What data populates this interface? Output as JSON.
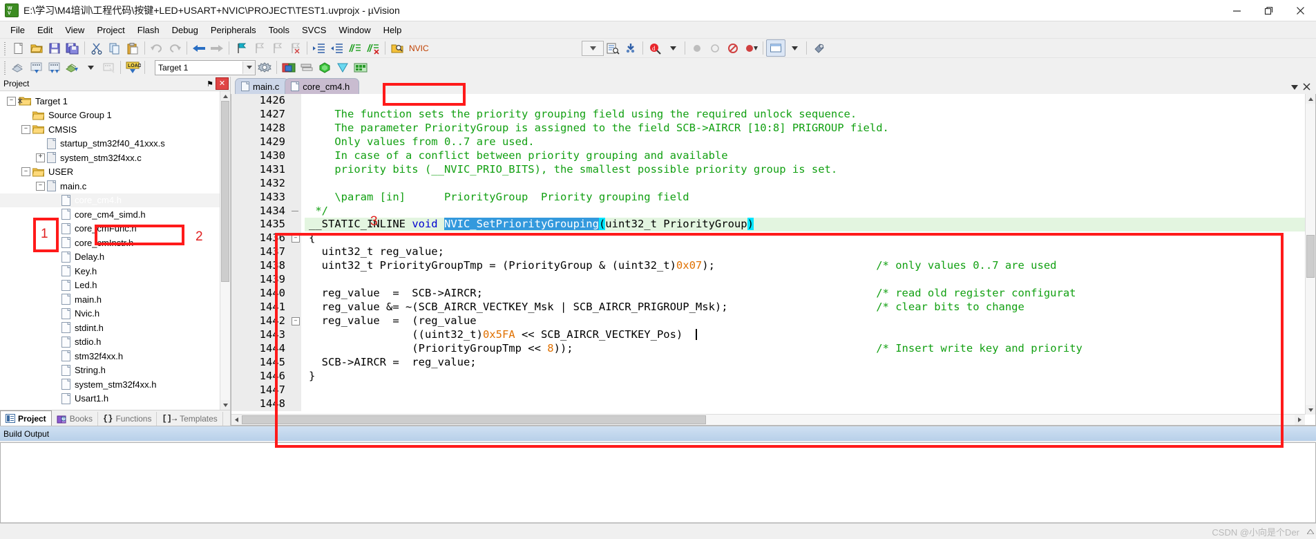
{
  "window": {
    "title": "E:\\学习\\M4培训\\工程代码\\按键+LED+USART+NVIC\\PROJECT\\TEST1.uvprojx - µVision",
    "minimize_label": "—",
    "maximize_label": "❐",
    "close_label": "✕"
  },
  "menu": {
    "items": [
      {
        "label": "File"
      },
      {
        "label": "Edit"
      },
      {
        "label": "View"
      },
      {
        "label": "Project"
      },
      {
        "label": "Flash"
      },
      {
        "label": "Debug"
      },
      {
        "label": "Peripherals"
      },
      {
        "label": "Tools"
      },
      {
        "label": "SVCS"
      },
      {
        "label": "Window"
      },
      {
        "label": "Help"
      }
    ]
  },
  "toolbar": {
    "find_value": "NVIC",
    "target_value": "Target 1"
  },
  "project_pane": {
    "title": "Project",
    "close_label": "✕",
    "pin_label": "⚑",
    "tree": [
      {
        "label": "Target 1",
        "indent": 1,
        "type": "target",
        "expander": "-"
      },
      {
        "label": "Source Group 1",
        "indent": 2,
        "type": "folder",
        "expander": ""
      },
      {
        "label": "CMSIS",
        "indent": 2,
        "type": "folder",
        "expander": "-"
      },
      {
        "label": "startup_stm32f40_41xxx.s",
        "indent": 3,
        "type": "file",
        "expander": ""
      },
      {
        "label": "system_stm32f4xx.c",
        "indent": 3,
        "type": "file",
        "expander": "+"
      },
      {
        "label": "USER",
        "indent": 2,
        "type": "folder",
        "expander": "-"
      },
      {
        "label": "main.c",
        "indent": 3,
        "type": "file",
        "expander": "-"
      },
      {
        "label": "core_cm4.h",
        "indent": 4,
        "type": "file",
        "expander": "",
        "selected": true
      },
      {
        "label": "core_cm4_simd.h",
        "indent": 4,
        "type": "file",
        "expander": ""
      },
      {
        "label": "core_cmFunc.h",
        "indent": 4,
        "type": "file",
        "expander": ""
      },
      {
        "label": "core_cmInstr.h",
        "indent": 4,
        "type": "file",
        "expander": ""
      },
      {
        "label": "Delay.h",
        "indent": 4,
        "type": "file",
        "expander": ""
      },
      {
        "label": "Key.h",
        "indent": 4,
        "type": "file",
        "expander": ""
      },
      {
        "label": "Led.h",
        "indent": 4,
        "type": "file",
        "expander": ""
      },
      {
        "label": "main.h",
        "indent": 4,
        "type": "file",
        "expander": ""
      },
      {
        "label": "Nvic.h",
        "indent": 4,
        "type": "file",
        "expander": ""
      },
      {
        "label": "stdint.h",
        "indent": 4,
        "type": "file",
        "expander": ""
      },
      {
        "label": "stdio.h",
        "indent": 4,
        "type": "file",
        "expander": ""
      },
      {
        "label": "stm32f4xx.h",
        "indent": 4,
        "type": "file",
        "expander": ""
      },
      {
        "label": "String.h",
        "indent": 4,
        "type": "file",
        "expander": ""
      },
      {
        "label": "system_stm32f4xx.h",
        "indent": 4,
        "type": "file",
        "expander": ""
      },
      {
        "label": "Usart1.h",
        "indent": 4,
        "type": "file",
        "expander": ""
      }
    ],
    "tabs": [
      {
        "label": "Project",
        "icon": "project-icon",
        "active": true
      },
      {
        "label": "Books",
        "icon": "books-icon",
        "active": false
      },
      {
        "label": "Functions",
        "icon": "braces-icon",
        "active": false
      },
      {
        "label": "Templates",
        "icon": "templates-icon",
        "active": false
      }
    ]
  },
  "editor": {
    "tabs": [
      {
        "label": "main.c",
        "active": false
      },
      {
        "label": "core_cm4.h",
        "active": true
      }
    ],
    "first_line": 1426,
    "lines": [
      {
        "n": 1426,
        "segs": [],
        "fold": ""
      },
      {
        "n": 1427,
        "segs": [
          {
            "t": "    The function sets the priority grouping field using the required unlock sequence.",
            "c": "cm"
          }
        ],
        "fold": ""
      },
      {
        "n": 1428,
        "segs": [
          {
            "t": "    The parameter PriorityGroup is assigned to the field SCB->AIRCR [10:8] PRIGROUP field.",
            "c": "cm"
          }
        ],
        "fold": ""
      },
      {
        "n": 1429,
        "segs": [
          {
            "t": "    Only values from 0..7 are used.",
            "c": "cm"
          }
        ],
        "fold": ""
      },
      {
        "n": 1430,
        "segs": [
          {
            "t": "    In case of a conflict between priority grouping and available",
            "c": "cm"
          }
        ],
        "fold": ""
      },
      {
        "n": 1431,
        "segs": [
          {
            "t": "    priority bits (__NVIC_PRIO_BITS), the smallest possible priority group is set.",
            "c": "cm"
          }
        ],
        "fold": ""
      },
      {
        "n": 1432,
        "segs": [],
        "fold": ""
      },
      {
        "n": 1433,
        "segs": [
          {
            "t": "    \\param [in]      PriorityGroup  Priority grouping field",
            "c": "cm"
          }
        ],
        "fold": ""
      },
      {
        "n": 1434,
        "segs": [
          {
            "t": " */",
            "c": "cm"
          }
        ],
        "fold": "dash"
      },
      {
        "n": 1435,
        "hl": true,
        "fold": "",
        "segs": [
          {
            "t": "__STATIC_INLINE ",
            "c": ""
          },
          {
            "t": "void",
            "c": "kw"
          },
          {
            "t": " ",
            "c": ""
          },
          {
            "t": "NVIC_SetPriorityGrouping",
            "c": "sel"
          },
          {
            "t": "(",
            "c": "selc"
          },
          {
            "t": "uint32_t PriorityGroup",
            "c": ""
          },
          {
            "t": ")",
            "c": "selc"
          }
        ]
      },
      {
        "n": 1436,
        "fold": "minus",
        "segs": [
          {
            "t": "{",
            "c": ""
          }
        ]
      },
      {
        "n": 1437,
        "fold": "",
        "segs": [
          {
            "t": "  uint32_t reg_value;",
            "c": ""
          }
        ]
      },
      {
        "n": 1438,
        "fold": "",
        "segs": [
          {
            "t": "  uint32_t PriorityGroupTmp = (PriorityGroup & (uint32_t)",
            "c": ""
          },
          {
            "t": "0x07",
            "c": "num"
          },
          {
            "t": ");",
            "c": ""
          }
        ],
        "right": {
          "t": "/* only values 0..7 are used",
          "c": "cm"
        }
      },
      {
        "n": 1439,
        "fold": "",
        "segs": []
      },
      {
        "n": 1440,
        "fold": "",
        "segs": [
          {
            "t": "  reg_value  =  SCB->AIRCR;",
            "c": ""
          }
        ],
        "right": {
          "t": "/* read old register configurat",
          "c": "cm"
        }
      },
      {
        "n": 1441,
        "fold": "",
        "segs": [
          {
            "t": "  reg_value &= ~(SCB_AIRCR_VECTKEY_Msk | SCB_AIRCR_PRIGROUP_Msk);",
            "c": ""
          }
        ],
        "right": {
          "t": "/* clear bits to change",
          "c": "cm"
        }
      },
      {
        "n": 1442,
        "fold": "minus",
        "segs": [
          {
            "t": "  reg_value  =  (reg_value",
            "c": ""
          }
        ]
      },
      {
        "n": 1443,
        "fold": "",
        "segs": [
          {
            "t": "                ((uint32_t)",
            "c": ""
          },
          {
            "t": "0x5FA",
            "c": "num"
          },
          {
            "t": " << SCB_AIRCR_VECTKEY_Pos)",
            "c": ""
          },
          {
            "t": "  |",
            "c": "caret"
          }
        ]
      },
      {
        "n": 1444,
        "fold": "",
        "segs": [
          {
            "t": "                (PriorityGroupTmp << ",
            "c": ""
          },
          {
            "t": "8",
            "c": "num"
          },
          {
            "t": "));",
            "c": ""
          }
        ],
        "right": {
          "t": "/* Insert write key and priority",
          "c": "cm"
        }
      },
      {
        "n": 1445,
        "fold": "",
        "segs": [
          {
            "t": "  SCB->AIRCR =  reg_value;",
            "c": ""
          }
        ]
      },
      {
        "n": 1446,
        "fold": "",
        "segs": [
          {
            "t": "}",
            "c": ""
          }
        ]
      },
      {
        "n": 1447,
        "fold": "",
        "segs": []
      },
      {
        "n": 1448,
        "fold": "",
        "segs": []
      }
    ]
  },
  "build_output": {
    "title": "Build Output",
    "content": ""
  },
  "status": {
    "watermark": "CSDN @小向是个Der"
  },
  "annotations": [
    {
      "num": "1"
    },
    {
      "num": "2"
    },
    {
      "num": "3"
    }
  ],
  "colors": {
    "annotation_red": "#ff1a1a",
    "comment_green": "#12a012",
    "keyword_blue": "#0000d0",
    "number_orange": "#e07000",
    "selection_blue": "#3399dd",
    "highlight_line": "#e3f5e0"
  }
}
